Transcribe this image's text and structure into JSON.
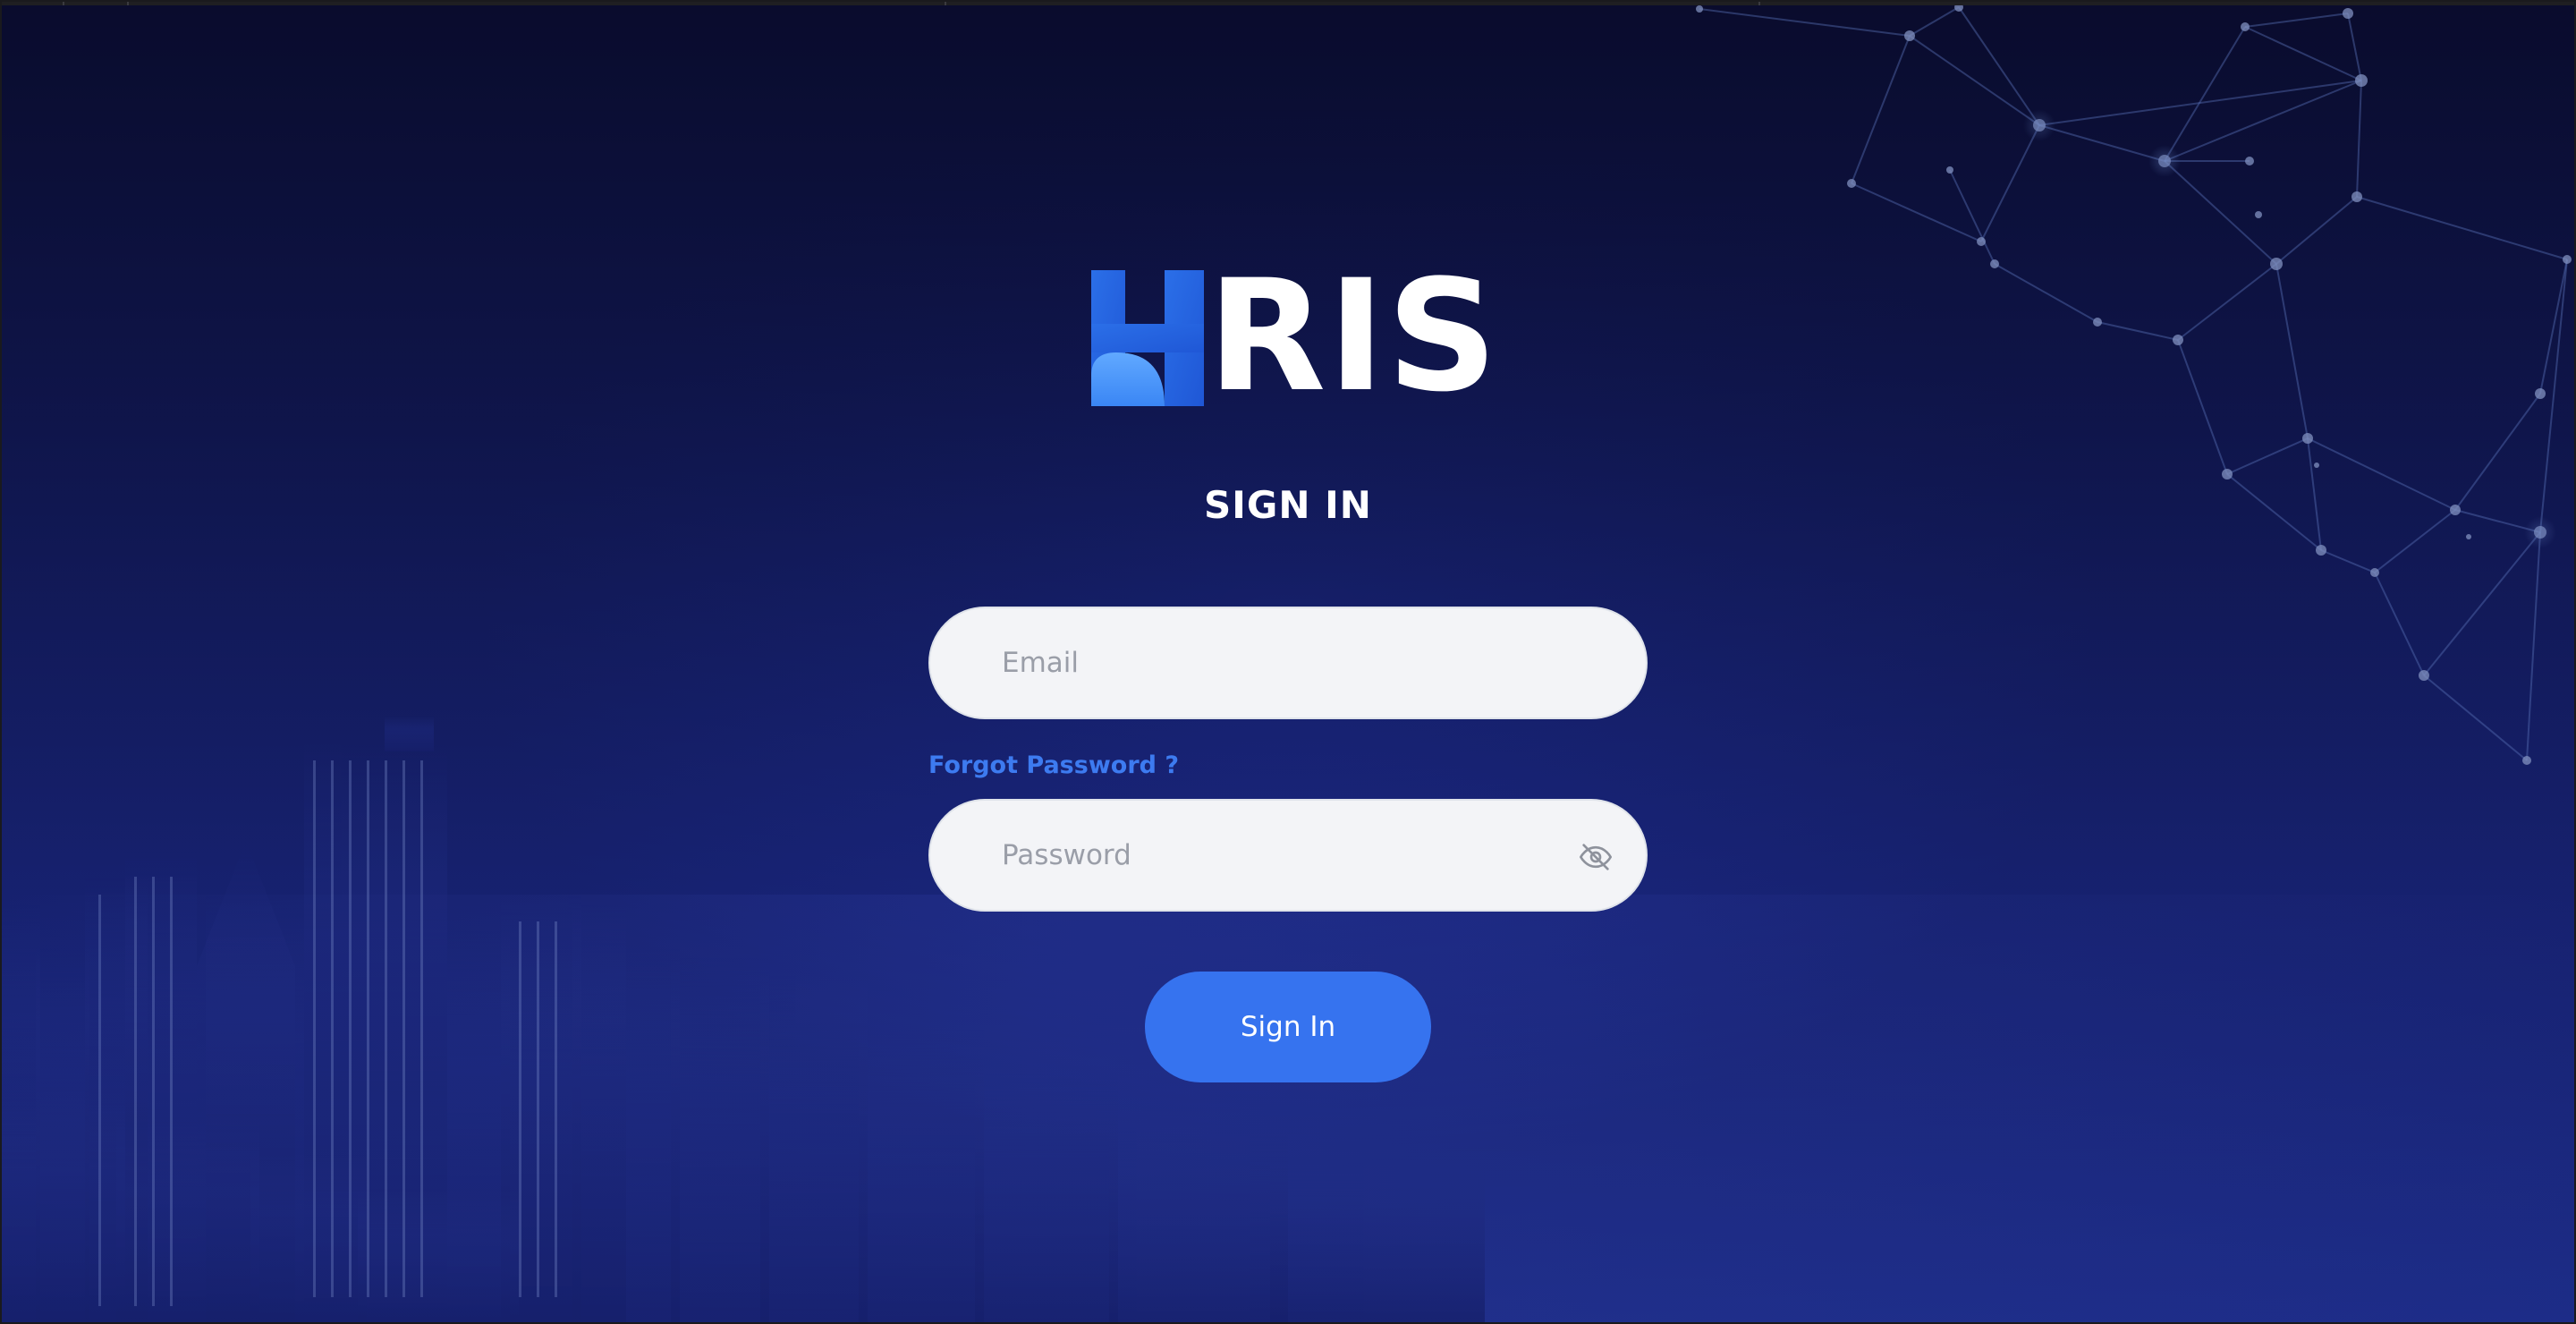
{
  "brand": {
    "logo_text": "HRIS",
    "logo_rest": "RIS",
    "accent": "#3673ef",
    "logo_blue": "#2a6ae8"
  },
  "signin": {
    "heading": "SIGN IN",
    "email_placeholder": "Email",
    "forgot_label": "Forgot Password ?",
    "password_placeholder": "Password",
    "password_toggle_icon": "eye-slash-icon",
    "button_label": "Sign In"
  },
  "colors": {
    "background_top": "#0a0c2e",
    "background_bottom": "#2438a8",
    "field_bg": "#f3f4f7",
    "link": "#3d7bf0"
  }
}
